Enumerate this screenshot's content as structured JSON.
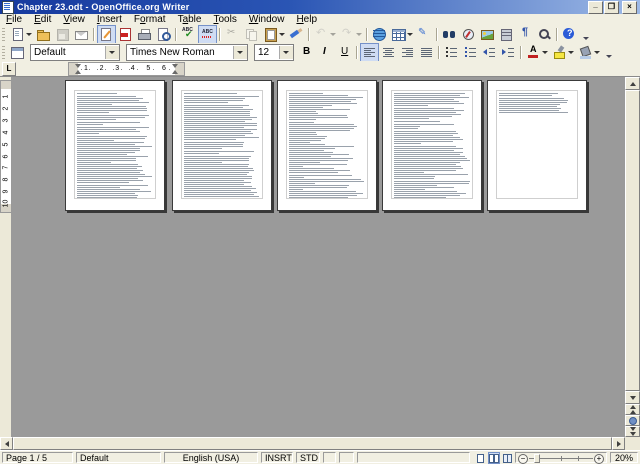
{
  "window": {
    "title": "Chapter 23.odt - OpenOffice.org Writer",
    "controls": [
      "minimize",
      "restore",
      "close"
    ]
  },
  "menu": {
    "items": [
      {
        "label": "File",
        "accel": 0
      },
      {
        "label": "Edit",
        "accel": 0
      },
      {
        "label": "View",
        "accel": 0
      },
      {
        "label": "Insert",
        "accel": 0
      },
      {
        "label": "Format",
        "accel": 1
      },
      {
        "label": "Table",
        "accel": 1
      },
      {
        "label": "Tools",
        "accel": 0
      },
      {
        "label": "Window",
        "accel": 0
      },
      {
        "label": "Help",
        "accel": 0
      }
    ]
  },
  "toolbars": {
    "standard": [
      {
        "name": "new-document",
        "label": "New",
        "dropdown": true
      },
      {
        "name": "open",
        "label": "Open"
      },
      {
        "name": "save",
        "label": "Save",
        "disabled": true
      },
      {
        "name": "document-as-email",
        "label": "Document as E-mail"
      },
      {
        "sep": true
      },
      {
        "name": "edit-file",
        "label": "Edit File",
        "pressed": true
      },
      {
        "name": "export-pdf",
        "label": "Export Directly as PDF"
      },
      {
        "name": "print",
        "label": "Print File Directly"
      },
      {
        "name": "page-preview",
        "label": "Page Preview"
      },
      {
        "sep": true
      },
      {
        "name": "spellcheck",
        "label": "Spellcheck"
      },
      {
        "name": "autospellcheck",
        "label": "AutoSpellcheck",
        "pressed": true
      },
      {
        "sep": true
      },
      {
        "name": "cut",
        "label": "Cut",
        "disabled": true
      },
      {
        "name": "copy",
        "label": "Copy",
        "disabled": true
      },
      {
        "name": "paste",
        "label": "Paste",
        "dropdown": true
      },
      {
        "name": "format-paintbrush",
        "label": "Format Paintbrush"
      },
      {
        "sep": true
      },
      {
        "name": "undo",
        "label": "Undo",
        "disabled": true,
        "dropdown": true
      },
      {
        "name": "redo",
        "label": "Redo",
        "disabled": true,
        "dropdown": true
      },
      {
        "sep": true
      },
      {
        "name": "hyperlink",
        "label": "Hyperlink"
      },
      {
        "name": "table",
        "label": "Table",
        "dropdown": true
      },
      {
        "name": "draw-functions",
        "label": "Show Draw Functions"
      },
      {
        "sep": true
      },
      {
        "name": "find-replace",
        "label": "Find & Replace"
      },
      {
        "name": "navigator",
        "label": "Navigator"
      },
      {
        "name": "gallery",
        "label": "Gallery"
      },
      {
        "name": "data-sources",
        "label": "Data Sources"
      },
      {
        "name": "nonprinting-characters",
        "label": "Nonprinting Characters"
      },
      {
        "name": "zoom",
        "label": "Zoom"
      },
      {
        "sep": true
      },
      {
        "name": "help",
        "label": "Help"
      },
      {
        "name": "toolbar-overflow",
        "label": "Toolbar Options",
        "overflow": true
      }
    ],
    "formatting": [
      {
        "name": "styles-and-formatting",
        "label": "Styles and Formatting"
      },
      {
        "combo": "paragraph_style",
        "width": 88
      },
      {
        "combo": "font_name",
        "width": 120
      },
      {
        "combo": "font_size",
        "width": 38
      },
      {
        "name": "bold",
        "label": "Bold"
      },
      {
        "name": "italic",
        "label": "Italic"
      },
      {
        "name": "underline",
        "label": "Underline"
      },
      {
        "sep": true
      },
      {
        "name": "align-left",
        "label": "Align Left",
        "pressed": true,
        "bars": true
      },
      {
        "name": "align-center",
        "label": "Centered",
        "bars": true
      },
      {
        "name": "align-right",
        "label": "Align Right",
        "bars": true
      },
      {
        "name": "justified",
        "label": "Justified",
        "bars": true
      },
      {
        "sep": true
      },
      {
        "name": "numbered-list",
        "label": "Numbering On/Off"
      },
      {
        "name": "bullet-list",
        "label": "Bullets On/Off"
      },
      {
        "name": "decrease-indent",
        "label": "Decrease Indent"
      },
      {
        "name": "increase-indent",
        "label": "Increase Indent"
      },
      {
        "sep": true
      },
      {
        "name": "font-color",
        "label": "Font Color",
        "dropdown": true
      },
      {
        "name": "highlighting",
        "label": "Highlighting",
        "dropdown": true
      },
      {
        "name": "background-color",
        "label": "Background Color",
        "dropdown": true
      },
      {
        "name": "toolbar-overflow",
        "label": "Toolbar Options",
        "overflow": true
      }
    ]
  },
  "formatting": {
    "paragraph_style": "Default",
    "font_name": "Times New Roman",
    "font_size": "12"
  },
  "ruler": {
    "tab_selector": "L",
    "horizontal_numbers": [
      "1",
      "2",
      "3",
      "4",
      "5",
      "6"
    ],
    "vertical_numbers": [
      "1",
      "2",
      "3",
      "4",
      "5",
      "6",
      "7",
      "8",
      "9",
      "10"
    ]
  },
  "document": {
    "page_count": 5,
    "current_page": 1,
    "pages": [
      {
        "lines": 52,
        "dialog": false
      },
      {
        "lines": 56,
        "dialog": false
      },
      {
        "lines": 58,
        "dialog": true
      },
      {
        "lines": 56,
        "dialog": false
      },
      {
        "lines": 10,
        "dialog": false
      }
    ]
  },
  "statusbar": {
    "page": "Page 1 / 5",
    "page_style": "Default",
    "language": "English (USA)",
    "insert_mode": "INSRT",
    "selection_mode": "STD",
    "zoom_level": "20%",
    "view_layouts": [
      "view-single-page",
      "view-multiple-pages",
      "view-book"
    ]
  },
  "colors": {
    "titlebar_start": "#16399e",
    "titlebar_end": "#9db9e6",
    "chrome": "#f1efe2",
    "canvas": "#9a9a9a",
    "accent_pressed": "#cfdcf3"
  }
}
